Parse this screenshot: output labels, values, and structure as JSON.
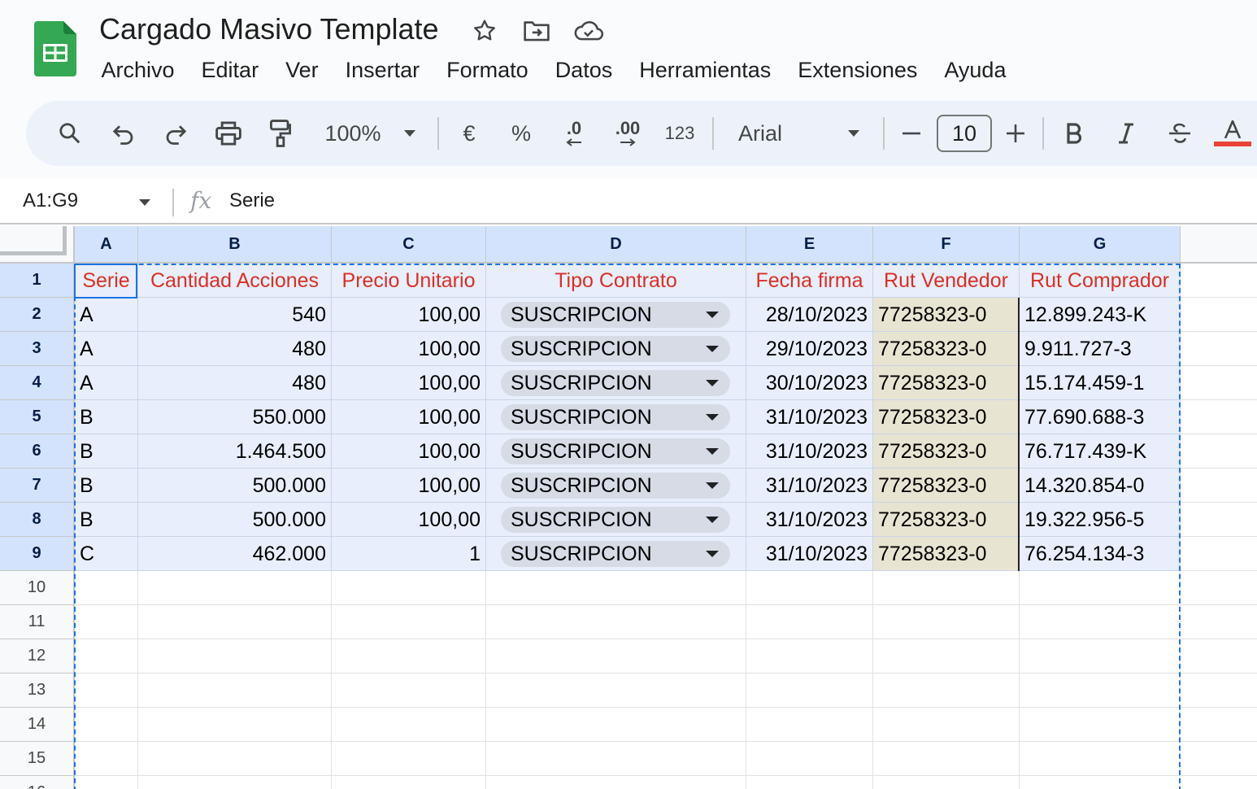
{
  "app": {
    "title": "Cargado Masivo Template"
  },
  "menu": [
    "Archivo",
    "Editar",
    "Ver",
    "Insertar",
    "Formato",
    "Datos",
    "Herramientas",
    "Extensiones",
    "Ayuda"
  ],
  "toolbar": {
    "zoom": "100%",
    "currency_label": "€",
    "percent_label": "%",
    "decrease_decimals_label": ".0",
    "increase_decimals_label": ".00",
    "number_format_label": "123",
    "font": "Arial",
    "font_size": "10",
    "text_color": "#ea4335"
  },
  "formula_bar": {
    "name_box": "A1:G9",
    "fx": "fx",
    "formula": "Serie"
  },
  "sheet": {
    "columns": [
      "A",
      "B",
      "C",
      "D",
      "E",
      "F",
      "G"
    ],
    "row_numbers": [
      "1",
      "2",
      "3",
      "4",
      "5",
      "6",
      "7",
      "8",
      "9",
      "10",
      "11",
      "12",
      "13",
      "14",
      "15",
      "16"
    ],
    "headers": [
      "Serie",
      "Cantidad Acciones",
      "Precio Unitario",
      "Tipo Contrato",
      "Fecha firma",
      "Rut Vendedor",
      "Rut Comprador"
    ],
    "rows": [
      [
        "A",
        "540",
        "100,00",
        "SUSCRIPCION",
        "28/10/2023",
        "77258323-0",
        "12.899.243-K"
      ],
      [
        "A",
        "480",
        "100,00",
        "SUSCRIPCION",
        "29/10/2023",
        "77258323-0",
        "9.911.727-3"
      ],
      [
        "A",
        "480",
        "100,00",
        "SUSCRIPCION",
        "30/10/2023",
        "77258323-0",
        "15.174.459-1"
      ],
      [
        "B",
        "550.000",
        "100,00",
        "SUSCRIPCION",
        "31/10/2023",
        "77258323-0",
        "77.690.688-3"
      ],
      [
        "B",
        "1.464.500",
        "100,00",
        "SUSCRIPCION",
        "31/10/2023",
        "77258323-0",
        "76.717.439-K"
      ],
      [
        "B",
        "500.000",
        "100,00",
        "SUSCRIPCION",
        "31/10/2023",
        "77258323-0",
        "14.320.854-0"
      ],
      [
        "B",
        "500.000",
        "100,00",
        "SUSCRIPCION",
        "31/10/2023",
        "77258323-0",
        "19.322.956-5"
      ],
      [
        "C",
        "462.000",
        "1",
        "SUSCRIPCION",
        "31/10/2023",
        "77258323-0",
        "76.254.134-3"
      ]
    ],
    "colors": {
      "header_text": "#d93025",
      "selection_fill": "#e8eefb",
      "rut_vendedor_fill": "#e8e4d2",
      "selection_border": "#1a73e8"
    }
  }
}
